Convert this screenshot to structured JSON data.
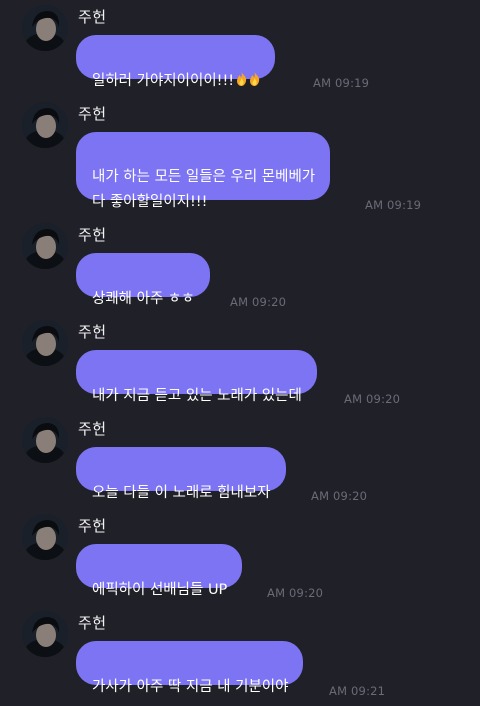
{
  "chat": {
    "messages": [
      {
        "sender": "주헌",
        "text": "일하러 가야지이이이!!!",
        "trailing_icons": [
          "fire-emoji",
          "fire-emoji"
        ],
        "time": "AM 09:19"
      },
      {
        "sender": "주헌",
        "text": "내가 하는 모든 일들은 우리 몬베베가\n다 좋아할일이지!!!",
        "time": "AM 09:19"
      },
      {
        "sender": "주헌",
        "text": "상쾌해 아주 ㅎㅎ",
        "time": "AM 09:20"
      },
      {
        "sender": "주헌",
        "text": "내가 지금 듣고 있는 노래가 있는데",
        "time": "AM 09:20"
      },
      {
        "sender": "주헌",
        "text": "오늘 다들 이 노래로 힘내보자",
        "time": "AM 09:20"
      },
      {
        "sender": "주헌",
        "text": "에픽하이 선배님들 UP",
        "time": "AM 09:20"
      },
      {
        "sender": "주헌",
        "text": "가사가 아주 딱 지금 내 기분이야",
        "time": "AM 09:21"
      }
    ]
  },
  "colors": {
    "background": "#202028",
    "bubble": "#7d74f3",
    "timestamp": "#6b6b78"
  }
}
